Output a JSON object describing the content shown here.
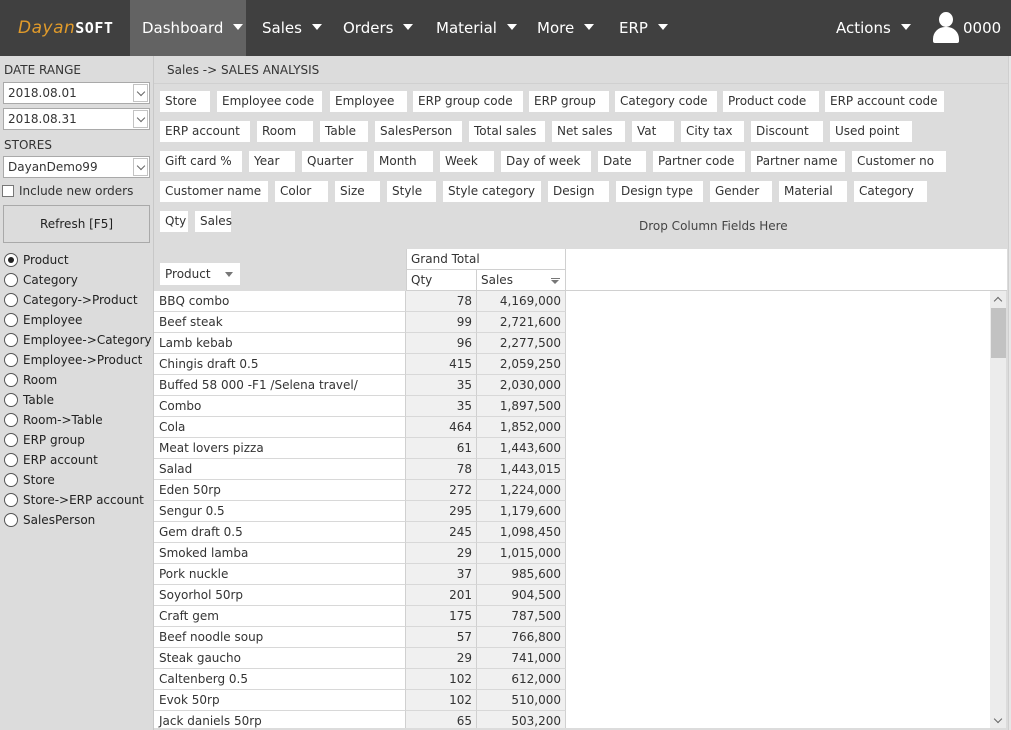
{
  "app": {
    "logo_part1": "Dayan",
    "logo_part2": "SOFT"
  },
  "nav": {
    "items": [
      {
        "label": "Dashboard",
        "active": true
      },
      {
        "label": "Sales"
      },
      {
        "label": "Orders"
      },
      {
        "label": "Material"
      },
      {
        "label": "More"
      },
      {
        "label": "ERP"
      }
    ],
    "actions_label": "Actions",
    "user_label": "0000"
  },
  "sidebar": {
    "date_range_label": "DATE RANGE",
    "date_from": "2018.08.01",
    "date_to": "2018.08.31",
    "stores_label": "STORES",
    "store_value": "DayanDemo99",
    "include_new_orders_label": "Include new orders",
    "include_new_orders_checked": false,
    "refresh_label": "Refresh [F5]",
    "report_types": [
      {
        "label": "Product",
        "selected": true
      },
      {
        "label": "Category"
      },
      {
        "label": "Category->Product"
      },
      {
        "label": "Employee"
      },
      {
        "label": "Employee->Category"
      },
      {
        "label": "Employee->Product"
      },
      {
        "label": "Room"
      },
      {
        "label": "Table"
      },
      {
        "label": "Room->Table"
      },
      {
        "label": "ERP group"
      },
      {
        "label": "ERP account"
      },
      {
        "label": "Store"
      },
      {
        "label": "Store->ERP account"
      },
      {
        "label": "SalesPerson"
      }
    ]
  },
  "main": {
    "breadcrumb": "Sales -> SALES ANALYSIS",
    "available_fields": [
      [
        "Store",
        "Employee code",
        "Employee",
        "ERP group code",
        "ERP group",
        "Category code",
        "Product code",
        "ERP account code"
      ],
      [
        "ERP account",
        "Room",
        "Table",
        "SalesPerson",
        "Total sales",
        "Net sales",
        "Vat",
        "City tax",
        "Discount",
        "Used point"
      ],
      [
        "Gift card %",
        "Year",
        "Quarter",
        "Month",
        "Week",
        "Day of week",
        "Date",
        "Partner code",
        "Partner name",
        "Customer no"
      ],
      [
        "Customer name",
        "Color",
        "Size",
        "Style",
        "Style category",
        "Design",
        "Design type",
        "Gender",
        "Material",
        "Category"
      ]
    ],
    "data_fields": [
      "Qty",
      "Sales"
    ],
    "drop_column_placeholder": "Drop Column Fields Here",
    "row_field": "Product",
    "grand_total_label": "Grand Total",
    "columns": {
      "qty": "Qty",
      "sales": "Sales"
    },
    "rows": [
      {
        "product": "BBQ combo",
        "qty": "78",
        "sales": "4,169,000"
      },
      {
        "product": "Beef steak",
        "qty": "99",
        "sales": "2,721,600"
      },
      {
        "product": "Lamb kebab",
        "qty": "96",
        "sales": "2,277,500"
      },
      {
        "product": "Chingis draft 0.5",
        "qty": "415",
        "sales": "2,059,250"
      },
      {
        "product": "Buffed 58 000 -F1 /Selena travel/",
        "qty": "35",
        "sales": "2,030,000"
      },
      {
        "product": "Combo",
        "qty": "35",
        "sales": "1,897,500"
      },
      {
        "product": "Cola",
        "qty": "464",
        "sales": "1,852,000"
      },
      {
        "product": "Meat lovers pizza",
        "qty": "61",
        "sales": "1,443,600"
      },
      {
        "product": "Salad",
        "qty": "78",
        "sales": "1,443,015"
      },
      {
        "product": "Eden 50rp",
        "qty": "272",
        "sales": "1,224,000"
      },
      {
        "product": "Sengur 0.5",
        "qty": "295",
        "sales": "1,179,600"
      },
      {
        "product": "Gem draft 0.5",
        "qty": "245",
        "sales": "1,098,450"
      },
      {
        "product": "Smoked lamba",
        "qty": "29",
        "sales": "1,015,000"
      },
      {
        "product": "Pork nuckle",
        "qty": "37",
        "sales": "985,600"
      },
      {
        "product": "Soyorhol 50rp",
        "qty": "201",
        "sales": "904,500"
      },
      {
        "product": "Craft gem",
        "qty": "175",
        "sales": "787,500"
      },
      {
        "product": "Beef noodle soup",
        "qty": "57",
        "sales": "766,800"
      },
      {
        "product": "Steak gaucho",
        "qty": "29",
        "sales": "741,000"
      },
      {
        "product": "Caltenberg 0.5",
        "qty": "102",
        "sales": "612,000"
      },
      {
        "product": "Evok 50rp",
        "qty": "102",
        "sales": "510,000"
      },
      {
        "product": "Jack daniels 50rp",
        "qty": "65",
        "sales": "503,200"
      }
    ]
  }
}
